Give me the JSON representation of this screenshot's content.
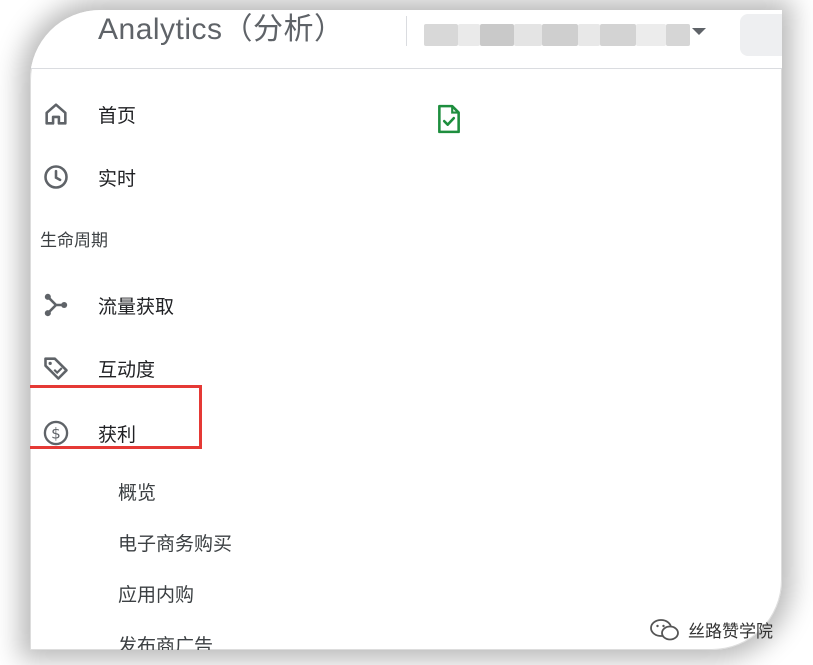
{
  "header": {
    "app_title": "Analytics（分析）",
    "account_selector": {
      "obscured": true,
      "dropdown_icon": "dropdown-arrow-icon"
    }
  },
  "nav": {
    "items": [
      {
        "label": "首页",
        "icon": "home-icon"
      },
      {
        "label": "实时",
        "icon": "clock-icon"
      }
    ],
    "section_label": "生命周期",
    "lifecycle_items": [
      {
        "label": "流量获取",
        "icon": "acquisition-icon"
      },
      {
        "label": "互动度",
        "icon": "engagement-tag-icon"
      },
      {
        "label": "获利",
        "icon": "dollar-circle-icon",
        "highlighted": true
      }
    ],
    "monetization_subitems": [
      "概览",
      "电子商务购买",
      "应用内购",
      "发布商广告"
    ]
  },
  "content": {
    "icon": "document-check-icon"
  },
  "watermark": {
    "text": "丝路赞学院",
    "icon": "wechat-icon"
  },
  "colors": {
    "highlight_border": "#e53935",
    "doc_icon": "#1e8e3e",
    "icon_gray": "#5f6368"
  }
}
